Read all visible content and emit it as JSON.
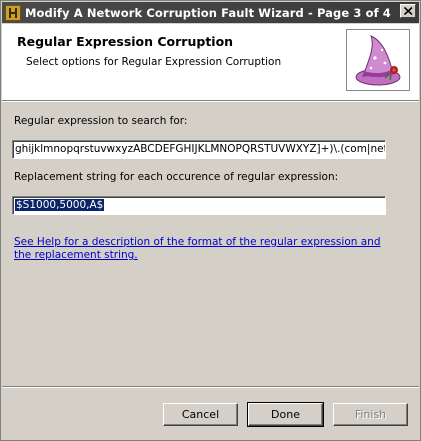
{
  "window": {
    "title": "Modify A Network Corruption Fault Wizard - Page 3 of 4"
  },
  "header": {
    "title": "Regular Expression Corruption",
    "subtitle": "Select options for Regular Expression Corruption"
  },
  "form": {
    "search_label": "Regular expression to search for:",
    "search_value": "ghijklmnopqrstuvwxyzABCDEFGHIJKLMNOPQRSTUVWXYZ]+)\\.(com|net|org)",
    "replace_label": "Replacement string for each occurence of regular expression:",
    "replace_value": "$S1000,5000,A$"
  },
  "help": {
    "link_text": "See Help for a description of the format of the regular expression and the replacement string."
  },
  "buttons": {
    "cancel": "Cancel",
    "done": "Done",
    "finish": "Finish"
  }
}
